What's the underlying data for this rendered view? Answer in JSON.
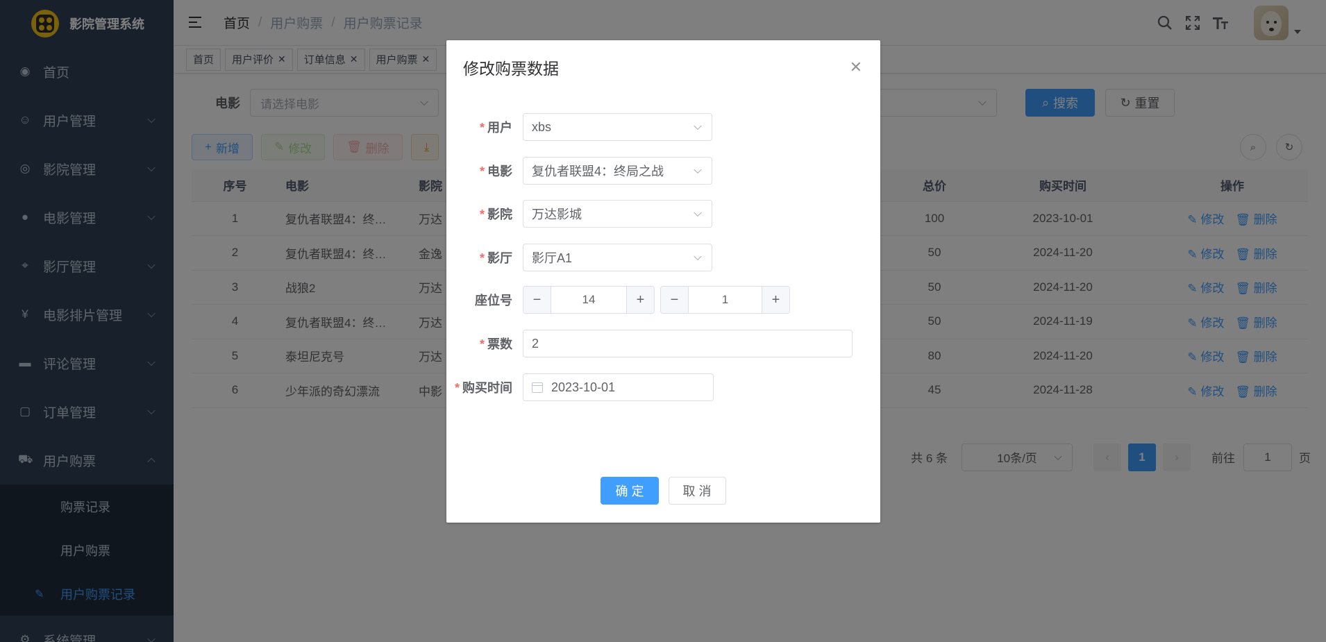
{
  "app": {
    "title": "影院管理系统"
  },
  "sidebar": {
    "items": [
      {
        "label": "首页",
        "icon": "dashboard-icon"
      },
      {
        "label": "用户管理",
        "icon": "user-icon"
      },
      {
        "label": "影院管理",
        "icon": "cinema-icon"
      },
      {
        "label": "电影管理",
        "icon": "github-icon"
      },
      {
        "label": "影厅管理",
        "icon": "location-icon"
      },
      {
        "label": "电影排片管理",
        "icon": "yen-icon"
      },
      {
        "label": "评论管理",
        "icon": "comment-icon"
      },
      {
        "label": "订单管理",
        "icon": "clipboard-icon"
      },
      {
        "label": "用户购票",
        "icon": "cart-icon"
      }
    ],
    "submenu": [
      {
        "label": "购票记录"
      },
      {
        "label": "用户购票"
      },
      {
        "label": "用户购票记录"
      }
    ],
    "tail": {
      "label": "系统管理"
    }
  },
  "breadcrumb": [
    "首页",
    "用户购票",
    "用户购票记录"
  ],
  "tags": [
    {
      "label": "首页"
    },
    {
      "label": "用户评价"
    },
    {
      "label": "订单信息"
    },
    {
      "label": "用户购票"
    }
  ],
  "search": {
    "movie_label": "电影",
    "movie_placeholder": "请选择电影",
    "search_button": "搜索",
    "reset_button": "重置"
  },
  "toolbar": {
    "add": "新增",
    "edit": "修改",
    "delete": "删除"
  },
  "table": {
    "headers": {
      "index": "序号",
      "movie": "电影",
      "cinema": "影院",
      "total": "总价",
      "time": "购买时间",
      "ops": "操作"
    },
    "rows": [
      {
        "index": "1",
        "movie": "复仇者联盟4：终…",
        "cinema": "万达",
        "total": "100",
        "time": "2023-10-01"
      },
      {
        "index": "2",
        "movie": "复仇者联盟4：终…",
        "cinema": "金逸",
        "total": "50",
        "time": "2024-11-20"
      },
      {
        "index": "3",
        "movie": "战狼2",
        "cinema": "万达",
        "total": "50",
        "time": "2024-11-20"
      },
      {
        "index": "4",
        "movie": "复仇者联盟4：终…",
        "cinema": "万达",
        "total": "50",
        "time": "2024-11-19"
      },
      {
        "index": "5",
        "movie": "泰坦尼克号",
        "cinema": "万达",
        "total": "80",
        "time": "2024-11-20"
      },
      {
        "index": "6",
        "movie": "少年派的奇幻漂流",
        "cinema": "中影",
        "total": "45",
        "time": "2024-11-28"
      }
    ],
    "edit_label": "修改",
    "delete_label": "删除"
  },
  "pagination": {
    "total": "共 6 条",
    "page_size": "10条/页",
    "current": "1",
    "goto_prefix": "前往",
    "goto_value": "1",
    "goto_suffix": "页"
  },
  "dialog": {
    "title": "修改购票数据",
    "fields": {
      "user": {
        "label": "用户",
        "value": "xbs"
      },
      "movie": {
        "label": "电影",
        "value": "复仇者联盟4：终局之战"
      },
      "cinema": {
        "label": "影院",
        "value": "万达影城"
      },
      "hall": {
        "label": "影厅",
        "value": "影厅A1"
      },
      "seat": {
        "label": "座位号",
        "row": "14",
        "col": "1"
      },
      "count": {
        "label": "票数",
        "value": "2"
      },
      "time": {
        "label": "购买时间",
        "value": "2023-10-01"
      }
    },
    "confirm": "确 定",
    "cancel": "取 消"
  },
  "colors": {
    "primary": "#409eff",
    "sidebar": "#304156",
    "danger": "#f56c6c"
  }
}
